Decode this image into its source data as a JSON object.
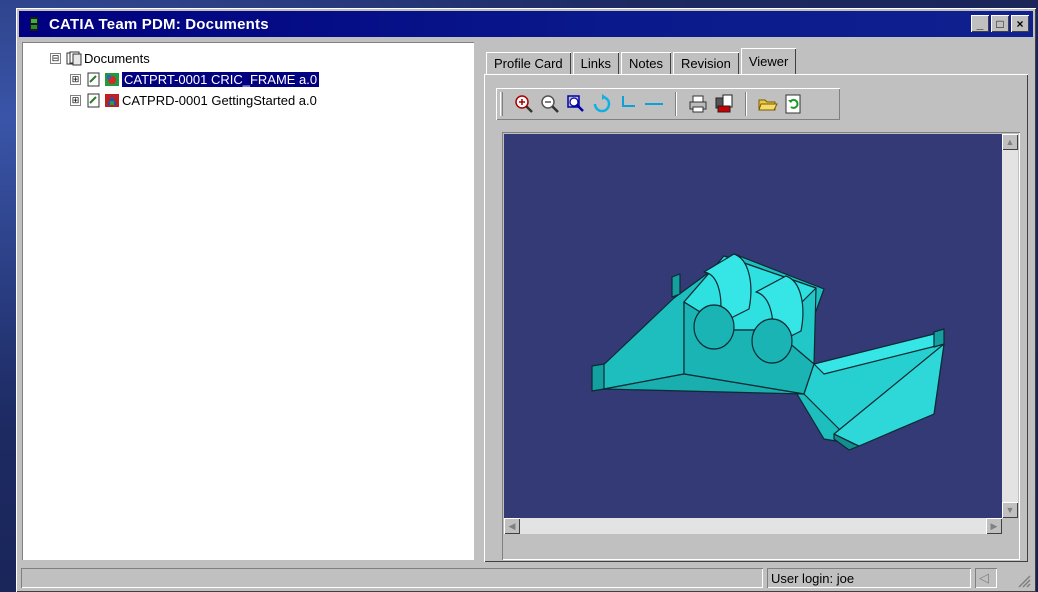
{
  "window": {
    "title": "CATIA Team PDM: Documents",
    "controls": {
      "minimize": "_",
      "maximize": "□",
      "close": "×"
    }
  },
  "tree": {
    "root": {
      "label": "Documents",
      "expander": "⊟"
    },
    "items": [
      {
        "label": "CATPRT-0001 CRIC_FRAME a.0",
        "expander": "⊞",
        "selected": true
      },
      {
        "label": "CATPRD-0001 GettingStarted a.0",
        "expander": "⊞",
        "selected": false
      }
    ]
  },
  "tabs": [
    {
      "label": "Profile Card",
      "active": false
    },
    {
      "label": "Links",
      "active": false
    },
    {
      "label": "Notes",
      "active": false
    },
    {
      "label": "Revision",
      "active": false
    },
    {
      "label": "Viewer",
      "active": true
    }
  ],
  "toolbar": {
    "icons": [
      "zoom-in-icon",
      "zoom-out-icon",
      "zoom-area-icon",
      "rotate-icon",
      "pan-icon",
      "fit-icon",
      "print-icon",
      "print-setup-icon",
      "open-folder-icon",
      "refresh-icon"
    ]
  },
  "colors": {
    "title_bar": "#000080",
    "viewer_background": "#333a75",
    "model_fill": "#22d6d6",
    "selection": "#000080"
  },
  "status": {
    "main": "",
    "user_login": "User login: joe"
  }
}
